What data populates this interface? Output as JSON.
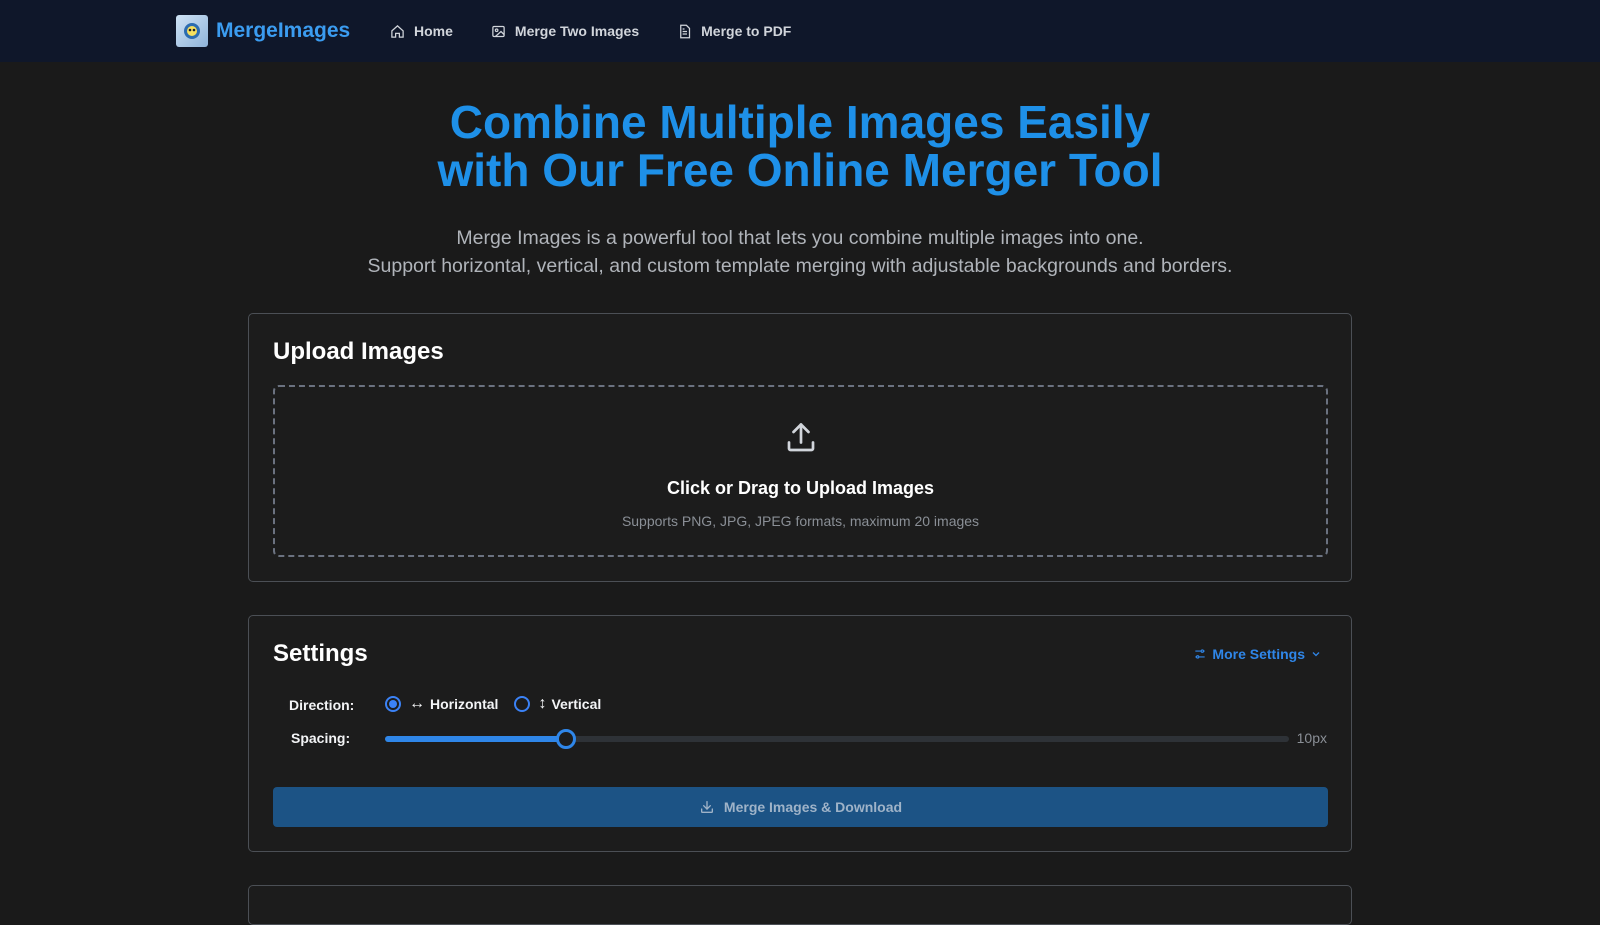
{
  "nav": {
    "brand": "MergeImages",
    "links": [
      {
        "label": "Home",
        "icon": "home-icon"
      },
      {
        "label": "Merge Two Images",
        "icon": "image-icon"
      },
      {
        "label": "Merge to PDF",
        "icon": "document-icon"
      }
    ]
  },
  "hero": {
    "title_line1": "Combine Multiple Images Easily",
    "title_line2": "with Our Free Online Merger Tool",
    "subtitle_line1": "Merge Images is a powerful tool that lets you combine multiple images into one.",
    "subtitle_line2": "Support horizontal, vertical, and custom template merging with adjustable backgrounds and borders."
  },
  "upload": {
    "title": "Upload Images",
    "dropzone_title": "Click or Drag to Upload Images",
    "dropzone_hint": "Supports PNG, JPG, JPEG formats, maximum 20 images",
    "icon": "upload-icon"
  },
  "settings": {
    "title": "Settings",
    "more_settings": "More Settings",
    "direction_label": "Direction:",
    "direction_options": [
      {
        "label": "Horizontal",
        "glyph": "↔",
        "selected": true
      },
      {
        "label": "Vertical",
        "glyph": "↕",
        "selected": false
      }
    ],
    "spacing_label": "Spacing:",
    "spacing_value": "10px",
    "spacing_fraction": 0.2,
    "merge_button": "Merge Images & Download"
  },
  "colors": {
    "accent": "#1e90e8",
    "nav_bg": "#0f172a",
    "page_bg": "#1a1a1a",
    "button_bg": "#1c5385"
  }
}
